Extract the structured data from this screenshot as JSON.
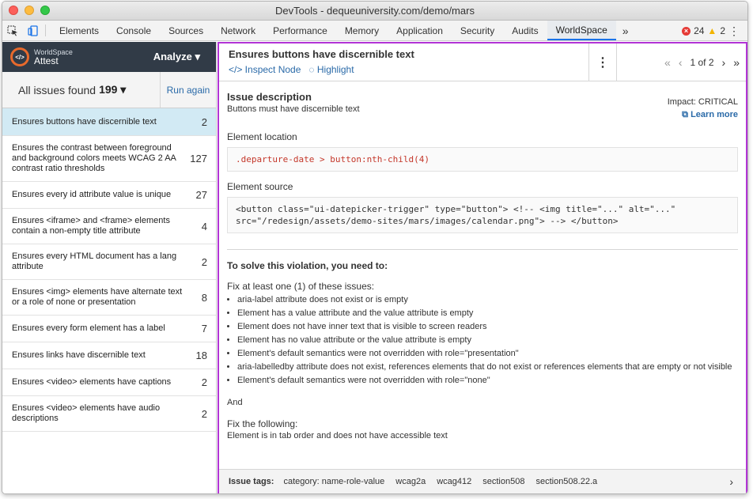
{
  "window": {
    "title": "DevTools - dequeuniversity.com/demo/mars"
  },
  "toolbar": {
    "tabs": [
      "Elements",
      "Console",
      "Sources",
      "Network",
      "Performance",
      "Memory",
      "Application",
      "Security",
      "Audits",
      "WorldSpace"
    ],
    "active_tab": "WorldSpace",
    "more": "»",
    "error_count": "24",
    "warning_count": "2"
  },
  "sidebar": {
    "brand_line1": "WorldSpace",
    "brand_line2": "Attest",
    "analyze_label": "Analyze ▾",
    "summary_label": "All issues found",
    "summary_count": "199 ▾",
    "run_again": "Run again",
    "issues": [
      {
        "label": "Ensures buttons have discernible text",
        "count": "2"
      },
      {
        "label": "Ensures the contrast between foreground and background colors meets WCAG 2 AA contrast ratio thresholds",
        "count": "127"
      },
      {
        "label": "Ensures every id attribute value is unique",
        "count": "27"
      },
      {
        "label": "Ensures <iframe> and <frame> elements contain a non-empty title attribute",
        "count": "4"
      },
      {
        "label": "Ensures every HTML document has a lang attribute",
        "count": "2"
      },
      {
        "label": "Ensures <img> elements have alternate text or a role of none or presentation",
        "count": "8"
      },
      {
        "label": "Ensures every form element has a label",
        "count": "7"
      },
      {
        "label": "Ensures links have discernible text",
        "count": "18"
      },
      {
        "label": "Ensures <video> elements have captions",
        "count": "2"
      },
      {
        "label": "Ensures <video> elements have audio descriptions",
        "count": "2"
      }
    ]
  },
  "detail": {
    "title": "Ensures buttons have discernible text",
    "inspect_node": "</> Inspect Node",
    "highlight": "◌ Highlight",
    "pager": "1 of 2",
    "issue_description_title": "Issue description",
    "issue_description": "Buttons must have discernible text",
    "impact": "Impact: CRITICAL",
    "learn_more": "Learn more",
    "element_location_label": "Element location",
    "element_location": ".departure-date > button:nth-child(4)",
    "element_source_label": "Element source",
    "element_source": "<button class=\"ui-datepicker-trigger\" type=\"button\"> <!-- <img title=\"...\" alt=\"...\" src=\"/redesign/assets/demo-sites/mars/images/calendar.png\"> --> </button>",
    "solve_title": "To solve this violation, you need to:",
    "fix_any_title": "Fix at least one (1) of these issues:",
    "fix_any": [
      "aria-label attribute does not exist or is empty",
      "Element has a value attribute and the value attribute is empty",
      "Element does not have inner text that is visible to screen readers",
      "Element has no value attribute or the value attribute is empty",
      "Element's default semantics were not overridden with role=\"presentation\"",
      "aria-labelledby attribute does not exist, references elements that do not exist or references elements that are empty or not visible",
      "Element's default semantics were not overridden with role=\"none\""
    ],
    "and_label": "And",
    "fix_all_title": "Fix the following:",
    "fix_all": "Element is in tab order and does not have accessible text"
  },
  "footer": {
    "title": "Issue tags:",
    "tags": [
      "category: name-role-value",
      "wcag2a",
      "wcag412",
      "section508",
      "section508.22.a"
    ]
  }
}
